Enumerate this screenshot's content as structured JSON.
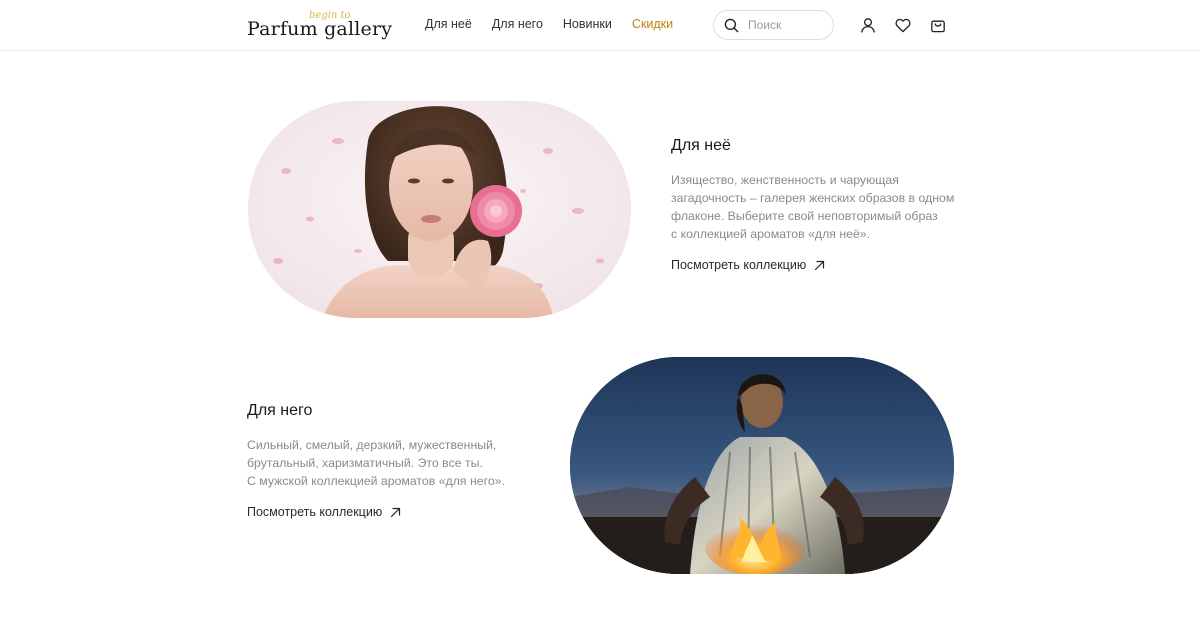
{
  "header": {
    "logo": {
      "main": "Parfum gallery",
      "sub": "begin to"
    },
    "nav": [
      {
        "label": "Для неё"
      },
      {
        "label": "Для него"
      },
      {
        "label": "Новинки"
      },
      {
        "label": "Скидки"
      }
    ],
    "accent_color": "#b8860b",
    "search": {
      "placeholder": "Поиск"
    },
    "icons": [
      "user-icon",
      "heart-icon",
      "cart-icon"
    ]
  },
  "sections": {
    "her": {
      "title": "Для неё",
      "text_lines": [
        "Изящество, женственность и чарующая",
        "загадочность – галерея женских образов в одном",
        "флаконе. Выберите свой неповторимый образ",
        "с коллекцией ароматов «для неё»."
      ],
      "link": "Посмотреть коллекцию",
      "image": "woman-with-peony-photo"
    },
    "him": {
      "title": "Для него",
      "text_lines": [
        "Сильный, смелый, дерзкий, мужественный,",
        "брутальный, харизматичный. Это все ты.",
        "С мужской коллекцией ароматов «для него»."
      ],
      "link": "Посмотреть коллекцию",
      "image": "man-by-campfire-photo"
    }
  }
}
